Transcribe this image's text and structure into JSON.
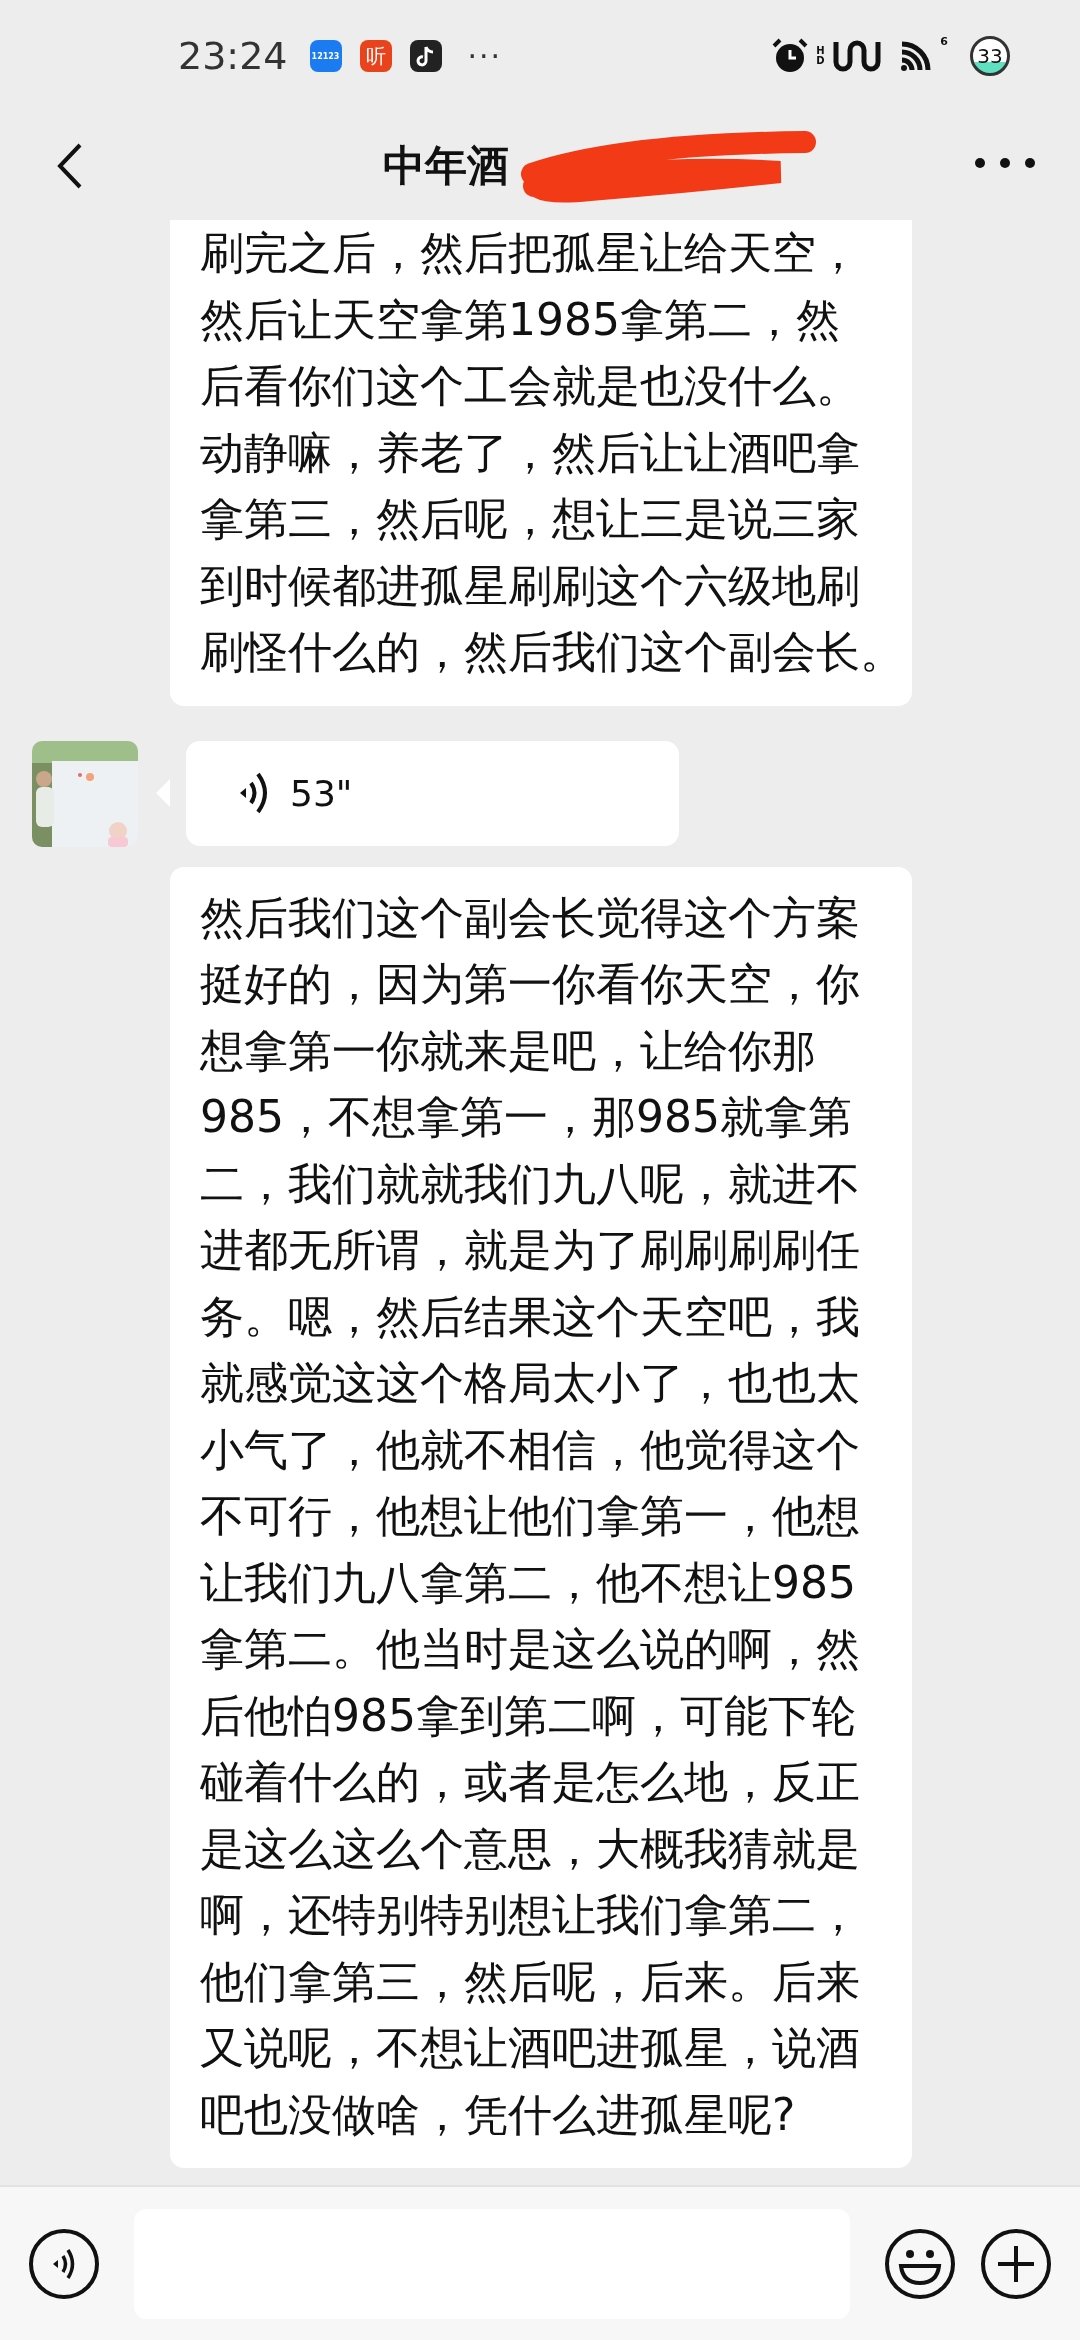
{
  "status_bar": {
    "time": "23:24",
    "app_badges": [
      {
        "kind": "traffic",
        "label": "12123"
      },
      {
        "kind": "listen",
        "label": "听"
      },
      {
        "kind": "music"
      }
    ],
    "overflow": "···",
    "network_label": "HD",
    "wifi_label": "6",
    "battery": "33"
  },
  "header": {
    "title": "中年酒"
  },
  "messages": [
    {
      "kind": "text",
      "lines": [
        "刷完之后，然后把孤星让给天空，",
        "然后让天空拿第1985拿第二，然",
        "后看你们这个工会就是也没什么。",
        "动静嘛，养老了，然后让让酒吧拿",
        "拿第三，然后呢，想让三是说三家",
        "到时候都进孤星刷刷这个六级地刷",
        "刷怪什么的，然后我们这个副会长。"
      ]
    },
    {
      "kind": "voice",
      "duration": "53\""
    },
    {
      "kind": "text",
      "lines": [
        "然后我们这个副会长觉得这个方案",
        "挺好的，因为第一你看你天空，你",
        "想拿第一你就来是吧，让给你那",
        "985，不想拿第一，那985就拿第",
        "二，我们就就我们九八呢，就进不",
        "进都无所谓，就是为了刷刷刷刷任",
        "务。嗯，然后结果这个天空吧，我",
        "就感觉这这个格局太小了，也也太",
        "小气了，他就不相信，他觉得这个",
        "不可行，他想让他们拿第一，他想",
        "让我们九八拿第二，他不想让985",
        "拿第二。他当时是这么说的啊，然",
        "后他怕985拿到第二啊，可能下轮",
        "碰着什么的，或者是怎么地，反正",
        "是这么这么个意思，大概我猜就是",
        "啊，还特别特别想让我们拿第二，",
        "他们拿第三，然后呢，后来。后来",
        "又说呢，不想让酒吧进孤星，说酒",
        "吧也没做啥，凭什么进孤星呢?"
      ]
    }
  ]
}
